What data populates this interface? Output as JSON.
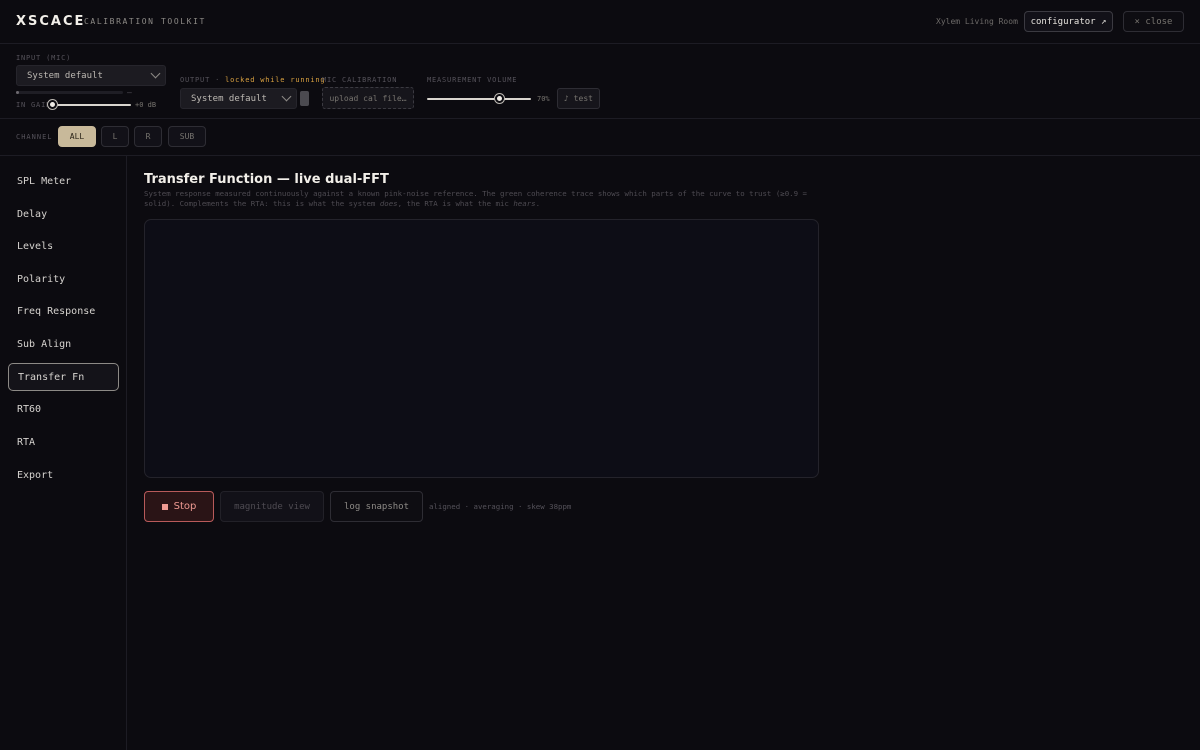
{
  "header": {
    "logo": "XSCACE",
    "subtitle": "CALIBRATION TOOLKIT",
    "room": "Xylem Living Room",
    "configurator_label": "configurator ↗",
    "close_label": "× close"
  },
  "controls": {
    "input": {
      "label": "INPUT (MIC)",
      "selected": "System default",
      "meter_level": 0.03,
      "meter_dash": "—",
      "gain_label": "IN GAIN",
      "gain_value": "+0 dB",
      "gain_level": 0.0
    },
    "output": {
      "label": "OUTPUT",
      "separator": " · ",
      "locked_note": "locked while running",
      "selected": "System default"
    },
    "mic_calibration": {
      "label": "MIC CALIBRATION",
      "upload_label": "upload cal file…"
    },
    "measurement_volume": {
      "label": "MEASUREMENT VOLUME",
      "value": "70%",
      "level": 0.7,
      "test_label": "♪ test"
    }
  },
  "channel": {
    "label": "CHANNEL",
    "options": [
      "ALL",
      "L",
      "R",
      "SUB"
    ],
    "selected": "ALL"
  },
  "sidebar": {
    "items": [
      {
        "label": "SPL Meter"
      },
      {
        "label": "Delay"
      },
      {
        "label": "Levels"
      },
      {
        "label": "Polarity"
      },
      {
        "label": "Freq Response"
      },
      {
        "label": "Sub Align"
      },
      {
        "label": "Transfer Fn",
        "active": true
      },
      {
        "label": "RT60"
      },
      {
        "label": "RTA"
      },
      {
        "label": "Export"
      }
    ]
  },
  "main": {
    "title": "Transfer Function — live dual-FFT",
    "description_part1": "System response measured continuously against a known pink-noise reference. The green coherence trace shows which parts of the curve to trust (≥0.9 = solid). Complements the RTA: this is what the system ",
    "description_em1": "does",
    "description_part2": ", the RTA is what the mic ",
    "description_em2": "hears",
    "description_part3": ".",
    "stop_label": "Stop",
    "magnitude_label": "magnitude view",
    "log_label": "log snapshot",
    "status": "aligned · averaging · skew 38ppm"
  },
  "colors": {
    "background": "#0c0b10",
    "accent_active": "#c8b99a",
    "locked_note": "#d9a140",
    "stop_red": "#ef9a92"
  }
}
